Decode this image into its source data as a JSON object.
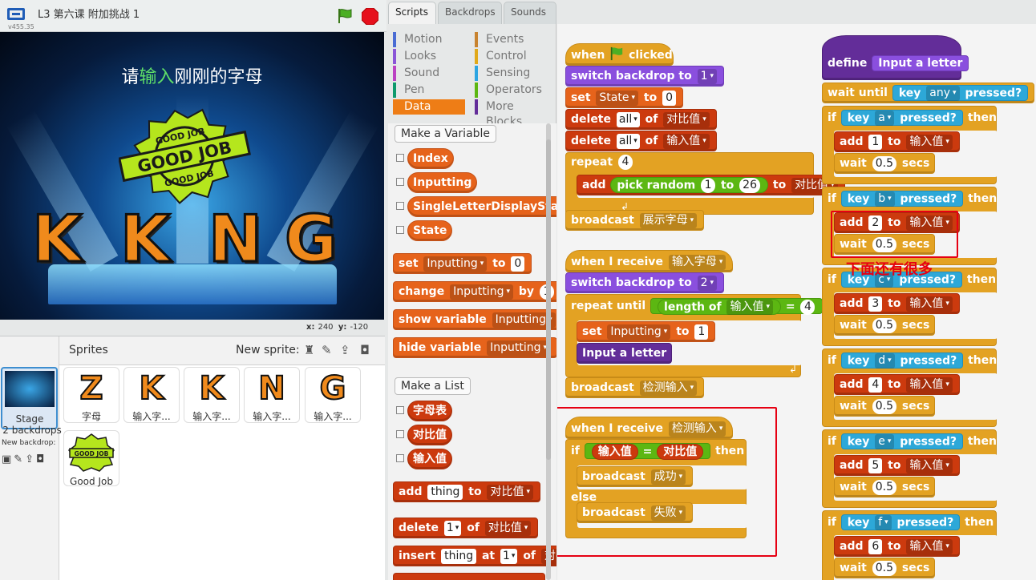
{
  "topbar": {
    "title": "L3 第六课 附加挑战 1",
    "version": "v455.35"
  },
  "stage": {
    "prompt_pre": "请",
    "prompt_hl": "输入",
    "prompt_post": "刚刚的字母",
    "badge": {
      "top": "GOOD JOB",
      "center": "GOOD JOB",
      "bottom": "GOOD JOB"
    },
    "letters": [
      "K",
      "K",
      "N",
      "G"
    ],
    "x_label": "x:",
    "x_value": "240",
    "y_label": "y:",
    "y_value": "-120"
  },
  "sprites_pane": {
    "title": "Sprites",
    "new_sprite_label": "New sprite:",
    "stage_label": "Stage",
    "backdrops_count": "2 backdrops",
    "new_backdrop_label": "New backdrop:",
    "items": [
      {
        "glyph": "Z",
        "name": "字母"
      },
      {
        "glyph": "K",
        "name": "输入字..."
      },
      {
        "glyph": "K",
        "name": "输入字..."
      },
      {
        "glyph": "N",
        "name": "输入字..."
      },
      {
        "glyph": "G",
        "name": "输入字..."
      },
      {
        "glyph": "GOOD JOB",
        "name": "Good Job"
      }
    ]
  },
  "tabs": [
    "Scripts",
    "Backdrops",
    "Sounds"
  ],
  "categories": {
    "left": [
      "Motion",
      "Looks",
      "Sound",
      "Pen",
      "Data"
    ],
    "right": [
      "Events",
      "Control",
      "Sensing",
      "Operators",
      "More Blocks"
    ],
    "colors": [
      "#4a6cd4",
      "#8a55d7",
      "#bb42c3",
      "#0e9a6c",
      "#ee7d16",
      "#c88330",
      "#e1a91a",
      "#2ca5e2",
      "#5cb712",
      "#632d99"
    ]
  },
  "palette": {
    "make_variable": "Make a Variable",
    "variables": [
      "Index",
      "Inputting",
      "SingleLetterDisplayStat",
      "State"
    ],
    "set": "set",
    "set_var": "Inputting",
    "to": "to",
    "set_val": "0",
    "change": "change",
    "change_var": "Inputting",
    "by": "by",
    "change_val": "1",
    "show": "show variable",
    "show_var": "Inputting",
    "hide": "hide variable",
    "hide_var": "Inputting",
    "make_list": "Make a List",
    "lists": [
      "字母表",
      "对比值",
      "输入值"
    ],
    "add": "add",
    "add_item": "thing",
    "add_to": "to",
    "add_list": "对比值",
    "delete": "delete",
    "delete_idx": "1",
    "of": "of",
    "delete_list": "对比值",
    "insert": "insert",
    "insert_item": "thing",
    "at": "at",
    "insert_idx": "1",
    "insert_of": "of",
    "insert_list": "对比"
  },
  "script1": {
    "when": "when",
    "clicked": "clicked",
    "switch": "switch backdrop to",
    "switch_val": "1",
    "set": "set",
    "set_var": "State",
    "to": "to",
    "set_val": "0",
    "del1": "delete",
    "del1_idx": "all",
    "of": "of",
    "del1_list": "对比值",
    "del2": "delete",
    "del2_idx": "all",
    "del2_list": "输入值",
    "repeat": "repeat",
    "repeat_val": "4",
    "add": "add",
    "pick": "pick random",
    "pick_from": "1",
    "pick_to_kw": "to",
    "pick_to": "26",
    "add_to": "to",
    "add_list": "对比值",
    "broadcast": "broadcast",
    "broadcast_msg": "展示字母"
  },
  "script2": {
    "when_receive": "when I receive",
    "msg": "输入字母",
    "switch": "switch backdrop to",
    "switch_val": "2",
    "repeat_until": "repeat until",
    "length_of": "length of",
    "list": "输入值",
    "eq": "=",
    "eq_val": "4",
    "set": "set",
    "set_var": "Inputting",
    "to": "to",
    "set_val": "1",
    "call": "Input a letter",
    "broadcast": "broadcast",
    "broadcast_msg": "检测输入"
  },
  "script3": {
    "when_receive": "when I receive",
    "msg": "检测输入",
    "if": "if",
    "left": "输入值",
    "eq": "=",
    "right": "对比值",
    "then": "then",
    "b1": "broadcast",
    "b1_msg": "成功",
    "else": "else",
    "b2": "broadcast",
    "b2_msg": "失败"
  },
  "script4": {
    "define": "define",
    "proc": "Input a letter",
    "wait_until": "wait until",
    "key": "key",
    "any": "any",
    "pressed": "pressed?",
    "branches": [
      {
        "key": "a",
        "value": "1"
      },
      {
        "key": "b",
        "value": "2"
      },
      {
        "key": "c",
        "value": "3"
      },
      {
        "key": "d",
        "value": "4"
      },
      {
        "key": "e",
        "value": "5"
      },
      {
        "key": "f",
        "value": "6"
      }
    ],
    "if": "if",
    "then": "then",
    "add": "add",
    "to": "to",
    "list": "输入值",
    "wait": "wait",
    "secs": "secs",
    "wait_val": "0.5"
  },
  "annotation": "下面还有很多"
}
